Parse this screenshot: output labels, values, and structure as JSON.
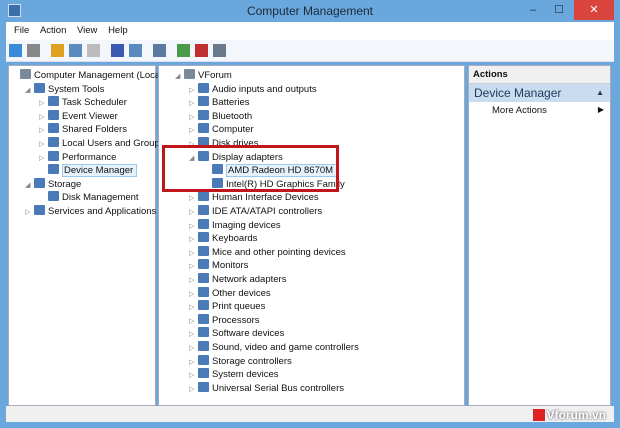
{
  "window": {
    "title": "Computer Management",
    "minimize": "–",
    "maximize": "☐",
    "close": "✕"
  },
  "menu": [
    "File",
    "Action",
    "View",
    "Help"
  ],
  "toolbar_icons": [
    "back-icon",
    "forward-icon",
    "up-icon",
    "show-hide-tree-icon",
    "properties-icon",
    "help-icon",
    "show-hide-action-icon",
    "scan-hardware-icon",
    "update-driver-icon",
    "uninstall-icon",
    "disable-icon"
  ],
  "left_tree": [
    {
      "label": "Computer Management (Local",
      "level": 0,
      "arrow": ""
    },
    {
      "label": "System Tools",
      "level": 1,
      "arrow": "◢"
    },
    {
      "label": "Task Scheduler",
      "level": 2,
      "arrow": "▷"
    },
    {
      "label": "Event Viewer",
      "level": 2,
      "arrow": "▷"
    },
    {
      "label": "Shared Folders",
      "level": 2,
      "arrow": "▷"
    },
    {
      "label": "Local Users and Groups",
      "level": 2,
      "arrow": "▷"
    },
    {
      "label": "Performance",
      "level": 2,
      "arrow": "▷"
    },
    {
      "label": "Device Manager",
      "level": 2,
      "arrow": "",
      "selected": true
    },
    {
      "label": "Storage",
      "level": 1,
      "arrow": "◢"
    },
    {
      "label": "Disk Management",
      "level": 2,
      "arrow": ""
    },
    {
      "label": "Services and Applications",
      "level": 1,
      "arrow": "▷"
    }
  ],
  "device_tree": [
    {
      "label": "VForum",
      "level": 0,
      "arrow": "◢"
    },
    {
      "label": "Audio inputs and outputs",
      "level": 1,
      "arrow": "▷"
    },
    {
      "label": "Batteries",
      "level": 1,
      "arrow": "▷"
    },
    {
      "label": "Bluetooth",
      "level": 1,
      "arrow": "▷"
    },
    {
      "label": "Computer",
      "level": 1,
      "arrow": "▷"
    },
    {
      "label": "Disk drives",
      "level": 1,
      "arrow": "▷"
    },
    {
      "label": "Display adapters",
      "level": 1,
      "arrow": "◢"
    },
    {
      "label": "AMD Radeon HD 8670M",
      "level": 2,
      "arrow": "",
      "selected": true
    },
    {
      "label": "Intel(R) HD Graphics Family",
      "level": 2,
      "arrow": ""
    },
    {
      "label": "Human Interface Devices",
      "level": 1,
      "arrow": "▷"
    },
    {
      "label": "IDE ATA/ATAPI controllers",
      "level": 1,
      "arrow": "▷"
    },
    {
      "label": "Imaging devices",
      "level": 1,
      "arrow": "▷"
    },
    {
      "label": "Keyboards",
      "level": 1,
      "arrow": "▷"
    },
    {
      "label": "Mice and other pointing devices",
      "level": 1,
      "arrow": "▷"
    },
    {
      "label": "Monitors",
      "level": 1,
      "arrow": "▷"
    },
    {
      "label": "Network adapters",
      "level": 1,
      "arrow": "▷"
    },
    {
      "label": "Other devices",
      "level": 1,
      "arrow": "▷"
    },
    {
      "label": "Print queues",
      "level": 1,
      "arrow": "▷"
    },
    {
      "label": "Processors",
      "level": 1,
      "arrow": "▷"
    },
    {
      "label": "Software devices",
      "level": 1,
      "arrow": "▷"
    },
    {
      "label": "Sound, video and game controllers",
      "level": 1,
      "arrow": "▷"
    },
    {
      "label": "Storage controllers",
      "level": 1,
      "arrow": "▷"
    },
    {
      "label": "System devices",
      "level": 1,
      "arrow": "▷"
    },
    {
      "label": "Universal Serial Bus controllers",
      "level": 1,
      "arrow": "▷"
    }
  ],
  "actions": {
    "header": "Actions",
    "section": "Device Manager",
    "more": "More Actions"
  },
  "watermark": "Vforum.vn",
  "colors": {
    "highlight_box": "#c0151b",
    "selection": "#e5f1fb",
    "action_section": "#c9dcf0"
  }
}
